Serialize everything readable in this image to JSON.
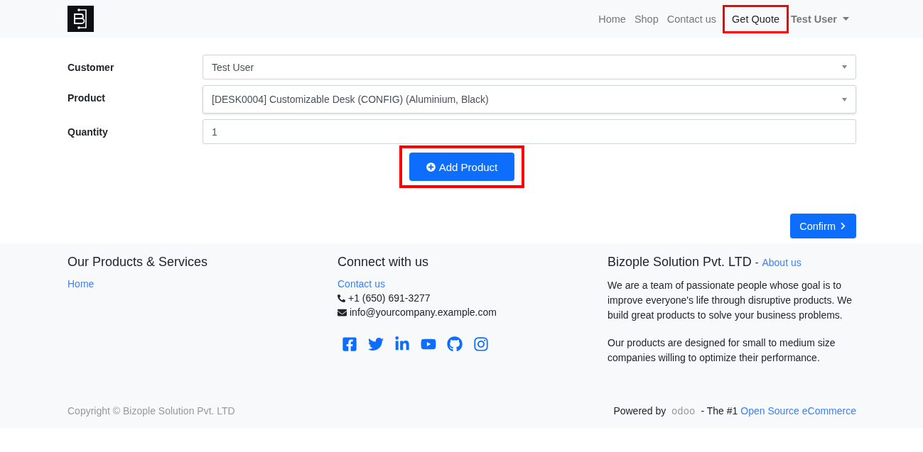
{
  "navbar": {
    "items": [
      {
        "label": "Home",
        "selected": false,
        "highlighted": false
      },
      {
        "label": "Shop",
        "selected": false,
        "highlighted": false
      },
      {
        "label": "Contact us",
        "selected": false,
        "highlighted": false
      },
      {
        "label": "Get Quote",
        "selected": true,
        "highlighted": true
      }
    ],
    "user": "Test User"
  },
  "form": {
    "fields": [
      {
        "label": "Customer",
        "kind": "select",
        "value": "Test User"
      },
      {
        "label": "Product",
        "kind": "select",
        "value": "[DESK0004] Customizable Desk (CONFIG) (Aluminium, Black)"
      },
      {
        "label": "Quantity",
        "kind": "input",
        "value": "1"
      }
    ],
    "add_button": {
      "label": "Add Product",
      "highlighted": true
    },
    "confirm_button": "Confirm"
  },
  "footer": {
    "products": {
      "title": "Our Products & Services",
      "links": [
        "Home"
      ]
    },
    "connect": {
      "title": "Connect with us",
      "link": "Contact us",
      "phone": "+1 (650) 691-3277",
      "email": "info@yourcompany.example.com"
    },
    "about": {
      "title": "Bizople Solution Pvt. LTD",
      "separator": "-",
      "link": "About us",
      "paragraphs": [
        "We are a team of passionate people whose goal is to improve everyone's life through disruptive products. We build great products to solve your business problems.",
        "Our products are designed for small to medium size companies willing to optimize their performance."
      ]
    },
    "copyright": "Copyright © Bizople Solution Pvt. LTD",
    "powered": {
      "prefix": "Powered by",
      "logo": "odoo",
      "middle": "- The #1",
      "link": "Open Source eCommerce"
    }
  }
}
